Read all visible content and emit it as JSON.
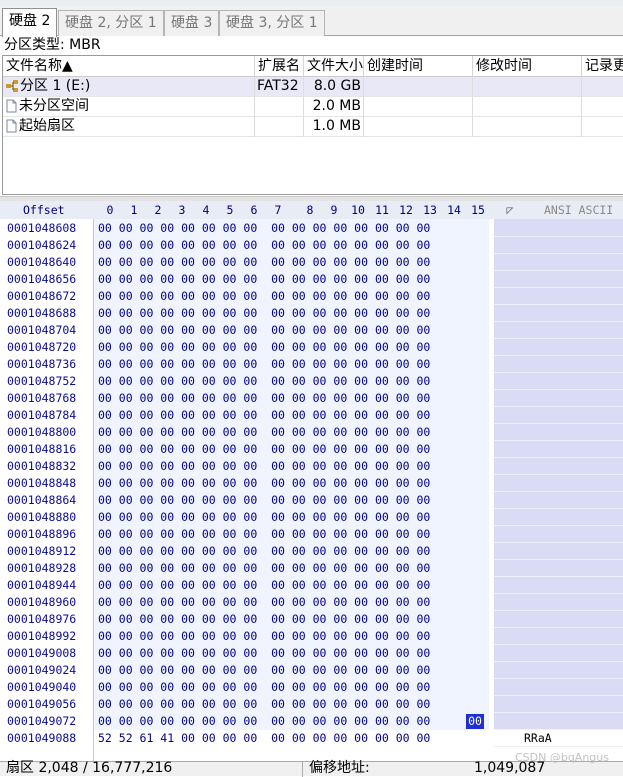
{
  "tabs": [
    {
      "label": "硬盘 2",
      "active": true
    },
    {
      "label": "硬盘 2, 分区 1",
      "active": false
    },
    {
      "label": "硬盘 3",
      "active": false
    },
    {
      "label": "硬盘 3, 分区 1",
      "active": false
    }
  ],
  "partition_type": "分区类型: MBR",
  "file_table": {
    "columns": [
      "文件名称▲",
      "扩展名",
      "文件大小",
      "创建时间",
      "修改时间",
      "记录更"
    ],
    "rows": [
      {
        "name": "分区 1 (E:)",
        "ext": "FAT32",
        "size": "8.0 GB",
        "icon": "partition-icon",
        "selected": true
      },
      {
        "name": "未分区空间",
        "ext": "",
        "size": "2.0 MB",
        "icon": "file-icon",
        "selected": false
      },
      {
        "name": "起始扇区",
        "ext": "",
        "size": "1.0 MB",
        "icon": "file-icon",
        "selected": false
      }
    ]
  },
  "hex": {
    "offset_label": "Offset",
    "columns": [
      "0",
      "1",
      "2",
      "3",
      "4",
      "5",
      "6",
      "7",
      "8",
      "9",
      "10",
      "11",
      "12",
      "13",
      "14",
      "15"
    ],
    "ansi_label": "ANSI ASCII",
    "rows": [
      {
        "offset": "0001048608",
        "bytes": "00 00 00 00 00 00 00 00  00 00 00 00 00 00 00 00",
        "ansi": ""
      },
      {
        "offset": "0001048624",
        "bytes": "00 00 00 00 00 00 00 00  00 00 00 00 00 00 00 00",
        "ansi": ""
      },
      {
        "offset": "0001048640",
        "bytes": "00 00 00 00 00 00 00 00  00 00 00 00 00 00 00 00",
        "ansi": ""
      },
      {
        "offset": "0001048656",
        "bytes": "00 00 00 00 00 00 00 00  00 00 00 00 00 00 00 00",
        "ansi": ""
      },
      {
        "offset": "0001048672",
        "bytes": "00 00 00 00 00 00 00 00  00 00 00 00 00 00 00 00",
        "ansi": ""
      },
      {
        "offset": "0001048688",
        "bytes": "00 00 00 00 00 00 00 00  00 00 00 00 00 00 00 00",
        "ansi": ""
      },
      {
        "offset": "0001048704",
        "bytes": "00 00 00 00 00 00 00 00  00 00 00 00 00 00 00 00",
        "ansi": ""
      },
      {
        "offset": "0001048720",
        "bytes": "00 00 00 00 00 00 00 00  00 00 00 00 00 00 00 00",
        "ansi": ""
      },
      {
        "offset": "0001048736",
        "bytes": "00 00 00 00 00 00 00 00  00 00 00 00 00 00 00 00",
        "ansi": ""
      },
      {
        "offset": "0001048752",
        "bytes": "00 00 00 00 00 00 00 00  00 00 00 00 00 00 00 00",
        "ansi": ""
      },
      {
        "offset": "0001048768",
        "bytes": "00 00 00 00 00 00 00 00  00 00 00 00 00 00 00 00",
        "ansi": ""
      },
      {
        "offset": "0001048784",
        "bytes": "00 00 00 00 00 00 00 00  00 00 00 00 00 00 00 00",
        "ansi": ""
      },
      {
        "offset": "0001048800",
        "bytes": "00 00 00 00 00 00 00 00  00 00 00 00 00 00 00 00",
        "ansi": ""
      },
      {
        "offset": "0001048816",
        "bytes": "00 00 00 00 00 00 00 00  00 00 00 00 00 00 00 00",
        "ansi": ""
      },
      {
        "offset": "0001048832",
        "bytes": "00 00 00 00 00 00 00 00  00 00 00 00 00 00 00 00",
        "ansi": ""
      },
      {
        "offset": "0001048848",
        "bytes": "00 00 00 00 00 00 00 00  00 00 00 00 00 00 00 00",
        "ansi": ""
      },
      {
        "offset": "0001048864",
        "bytes": "00 00 00 00 00 00 00 00  00 00 00 00 00 00 00 00",
        "ansi": ""
      },
      {
        "offset": "0001048880",
        "bytes": "00 00 00 00 00 00 00 00  00 00 00 00 00 00 00 00",
        "ansi": ""
      },
      {
        "offset": "0001048896",
        "bytes": "00 00 00 00 00 00 00 00  00 00 00 00 00 00 00 00",
        "ansi": ""
      },
      {
        "offset": "0001048912",
        "bytes": "00 00 00 00 00 00 00 00  00 00 00 00 00 00 00 00",
        "ansi": ""
      },
      {
        "offset": "0001048928",
        "bytes": "00 00 00 00 00 00 00 00  00 00 00 00 00 00 00 00",
        "ansi": ""
      },
      {
        "offset": "0001048944",
        "bytes": "00 00 00 00 00 00 00 00  00 00 00 00 00 00 00 00",
        "ansi": ""
      },
      {
        "offset": "0001048960",
        "bytes": "00 00 00 00 00 00 00 00  00 00 00 00 00 00 00 00",
        "ansi": ""
      },
      {
        "offset": "0001048976",
        "bytes": "00 00 00 00 00 00 00 00  00 00 00 00 00 00 00 00",
        "ansi": ""
      },
      {
        "offset": "0001048992",
        "bytes": "00 00 00 00 00 00 00 00  00 00 00 00 00 00 00 00",
        "ansi": ""
      },
      {
        "offset": "0001049008",
        "bytes": "00 00 00 00 00 00 00 00  00 00 00 00 00 00 00 00",
        "ansi": ""
      },
      {
        "offset": "0001049024",
        "bytes": "00 00 00 00 00 00 00 00  00 00 00 00 00 00 00 00",
        "ansi": ""
      },
      {
        "offset": "0001049040",
        "bytes": "00 00 00 00 00 00 00 00  00 00 00 00 00 00 00 00",
        "ansi": ""
      },
      {
        "offset": "0001049056",
        "bytes": "00 00 00 00 00 00 00 00  00 00 00 00 00 00 00 00",
        "ansi": ""
      },
      {
        "offset": "0001049072",
        "bytes": "00 00 00 00 00 00 00 00  00 00 00 00 00 00 00 00",
        "ansi": ""
      },
      {
        "offset": "0001049088",
        "bytes": "52 52 61 41 00 00 00 00  00 00 00 00 00 00 00 00",
        "ansi": "RRaA"
      }
    ],
    "cursor_value": "00"
  },
  "status": {
    "sector": "扇区 2,048 / 16,777,216",
    "offset_label": "偏移地址:",
    "offset_value": "1,049,087"
  },
  "watermark": "CSDN @bqAngus"
}
